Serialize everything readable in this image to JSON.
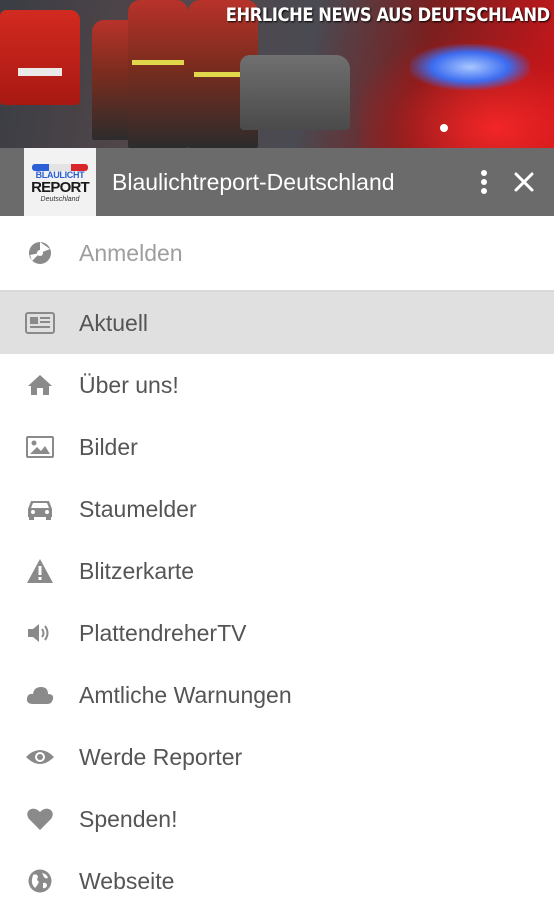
{
  "banner": {
    "tagline": "EHRLICHE NEWS AUS DEUTSCHLAND"
  },
  "appbar": {
    "logo": {
      "line1": "BLAULICHT",
      "line2": "REPORT",
      "line3": "Deutschland"
    },
    "title": "Blaulichtreport-Deutschland",
    "more_icon": "more-vert-icon",
    "close_icon": "close-icon"
  },
  "menu": {
    "login": {
      "label": "Anmelden",
      "icon": "login-icon"
    },
    "items": [
      {
        "label": "Aktuell",
        "icon": "newspaper-icon",
        "active": true
      },
      {
        "label": "Über uns!",
        "icon": "home-icon"
      },
      {
        "label": "Bilder",
        "icon": "image-icon"
      },
      {
        "label": "Staumelder",
        "icon": "car-icon"
      },
      {
        "label": "Blitzerkarte",
        "icon": "warning-icon"
      },
      {
        "label": "PlattendreherTV",
        "icon": "volume-icon"
      },
      {
        "label": "Amtliche Warnungen",
        "icon": "cloud-icon"
      },
      {
        "label": "Werde Reporter",
        "icon": "eye-icon"
      },
      {
        "label": "Spenden!",
        "icon": "heart-icon"
      },
      {
        "label": "Webseite",
        "icon": "globe-icon"
      }
    ]
  },
  "colors": {
    "appbar": "#6b6b6b",
    "active_row": "#e0e0e0",
    "icon": "#8a8a8a",
    "text": "#555555"
  }
}
